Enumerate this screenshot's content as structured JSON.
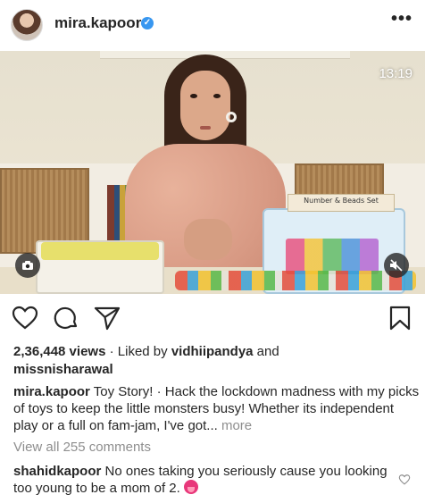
{
  "header": {
    "username": "mira.kapoor",
    "verified_badge": "✓",
    "more_label": "•••"
  },
  "video": {
    "timestamp": "13:19",
    "product_label": "Number & Beads Set",
    "camera_icon": "camera-icon",
    "mute_icon": "muted-speaker-icon"
  },
  "actions": {
    "icons": [
      "heart-icon",
      "comment-bubble-icon",
      "paper-plane-icon",
      "bookmark-icon"
    ]
  },
  "stats": {
    "views": "2,36,448 views",
    "separator": "·",
    "liked_by_prefix": "Liked by",
    "liked_by_user1": "vidhiipandya",
    "and": "and",
    "liked_by_user2": "missnisharawal"
  },
  "caption": {
    "username": "mira.kapoor",
    "text": "Toy Story! · Hack the lockdown madness with my picks of toys to keep the little monsters busy! Whether its independent play or a full on fam-jam, I've got...",
    "more_label": "more"
  },
  "comments": {
    "view_all": "View all 255 comments",
    "items": [
      {
        "username": "shahidkapoor",
        "text": "No ones taking you seriously cause you looking too young to be a mom of 2.",
        "emoji_icon": "tongue-face-emoji"
      }
    ]
  },
  "colors": {
    "text": "#262626",
    "muted": "#8e8e8e",
    "verified": "#3897f0"
  }
}
